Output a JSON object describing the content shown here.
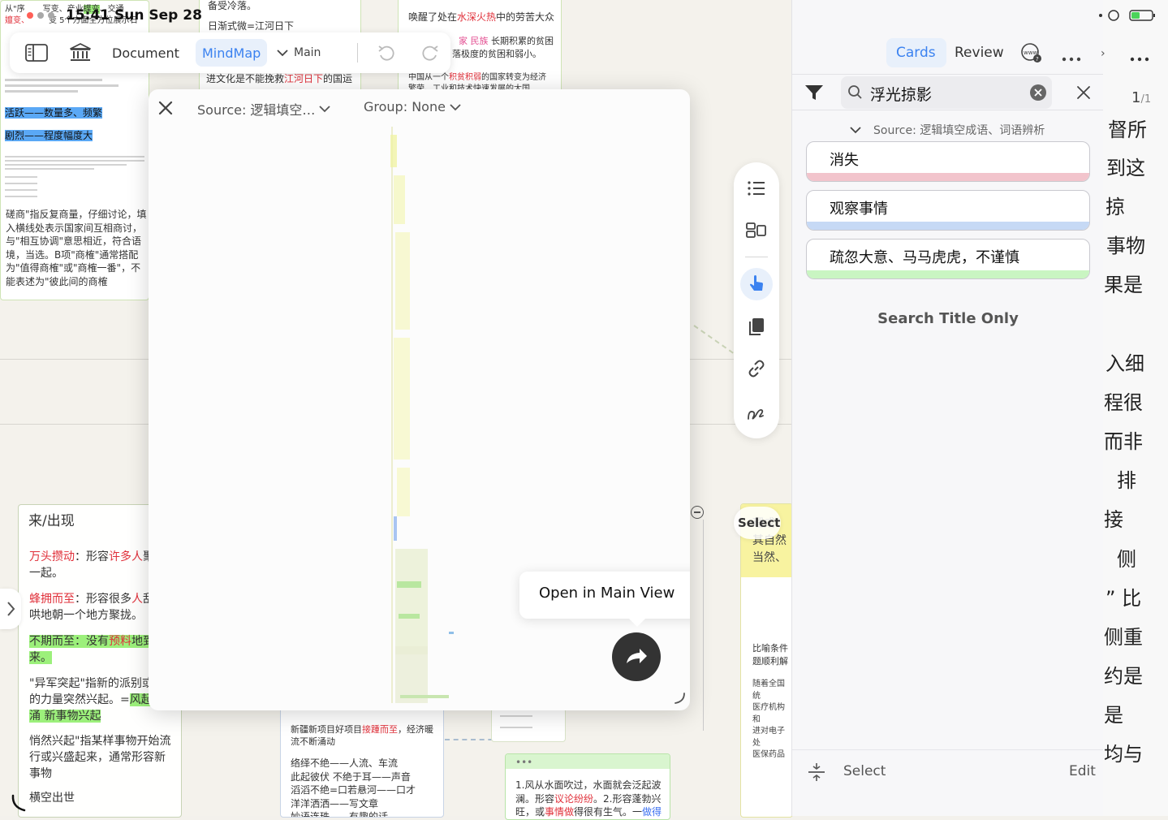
{
  "status": {
    "time_date": "15:41 Sun Sep 28"
  },
  "toolbar": {
    "document_label": "Document",
    "mindmap_label": "MindMap",
    "main_label": "Main"
  },
  "popup": {
    "source_label": "Source: 逻辑填空…",
    "group_label": "Group: None",
    "open_in_main_label": "Open in Main View"
  },
  "panel": {
    "tab_cards": "Cards",
    "tab_review": "Review",
    "search_value": "浮光掠影",
    "page_indicator": "1",
    "page_total": "/1",
    "source_filter": "Source: 逻辑填空成语、词语辨析",
    "cards": [
      {
        "label": "消失",
        "color": "#f2c4cc"
      },
      {
        "label": "观察事情",
        "color": "#c6d9f5"
      },
      {
        "label": "疏忽大意、马马虎虎，不谨慎",
        "color": "#c9f5c2"
      }
    ],
    "search_title_only": "Search Title Only",
    "select_label": "Select",
    "edit_label": "Edit"
  },
  "canvas": {
    "top_left_card": {
      "line1": "从\"序",
      "line1b": "写变、产业",
      "line1c": "蝶变",
      "line1d": "、交通",
      "line2": "嬗变、",
      "line2b": "变 5个方面全方位展示石",
      "highlight1": "活跃——数量多、频繁",
      "highlight2": "剧烈——程度幅度大",
      "para": "磋商\"指反复商量，仔细讨论，填入横线处表示国家间互相商讨，与\"相互协调\"意思相近，符合语境，当选。B项\"商榷\"通常搭配为\"值得商榷\"或\"商榷一番\"，不能表述为\"彼此间的商榷"
    },
    "top_mid_card": {
      "line1": "备受冷落。",
      "line2": "日渐式微=江河日下",
      "line3a": "进文化是不能挽救",
      "line3b": "江河日下",
      "line3c": "的国运"
    },
    "top_right_card": {
      "line1a": "唤醒了处在",
      "line1b": "水深火热",
      "line1c": "中的劳苦大众",
      "line2a": "家 民族",
      "line2b": " 长期积累的贫困",
      "line3": "落极度的贫困和弱小。",
      "line4a": "中国从一个",
      "line4b": "积贫积弱",
      "line4c": "的国家转变为经济",
      "line5": "繁荣、工业和技术快速发展的大国"
    },
    "bottom_left_card": {
      "title": "来/出现",
      "p1a": "万头攒动",
      "p1b": "：形容",
      "p1c": "许多人",
      "p1d": "聚在一起。",
      "p2a": "蜂拥而至",
      "p2b": "：形容很多",
      "p2c": "人",
      "p2d": "乱哄哄地朝一个地方聚拢。",
      "p3a": "不期而至：没有",
      "p3b": "预料",
      "p3c": "地到来。",
      "p4a": "\"异军突起\"指新的派别或新的力量突然兴起。=",
      "p4b": "风起",
      "p4c": "涌   新事物兴起",
      "p5": "悄然兴起\"指某样事物开始流行或兴盛起来，通常形容新事物",
      "p6": "横空出世"
    },
    "bottom_mid_card": {
      "line1a": "新疆新项目好项目",
      "line1b": "接踵而至",
      "line1c": "，经济暖流不断涌动",
      "line2": "络绎不绝——人流、车流",
      "line3": "此起彼伏 不绝于耳——声音",
      "line4": "滔滔不绝=口若悬河——口才",
      "line5": "洋洋洒洒——写文章",
      "line6": "妙语连珠——有趣的话"
    },
    "bottom_right_card": {
      "line1a": "1.风从水面吹过，水面就会泛起波澜。形容",
      "line1b": "议论纷纷",
      "line1c": "。2.形容蓬勃兴旺，或",
      "line1d": "事情做",
      "line1e": "得很有生气。一",
      "line1f": "做得"
    },
    "right_edge_card": {
      "select": "Select",
      "t1": "理成",
      "t2": "其自然",
      "t3": "当然、",
      "t4": "比喻条件",
      "t5": "题顺利解",
      "t6": "随着全国统",
      "t7": "医疗机构和",
      "t8": "进对电子处",
      "t9": "医保药品"
    },
    "far_right_text": [
      "督所",
      "到这",
      "掠",
      "事物",
      "果是",
      "入细",
      "程很",
      "而非",
      "排",
      "接",
      "侧",
      "” 比",
      "侧重",
      "约是",
      "是",
      "均与"
    ]
  }
}
